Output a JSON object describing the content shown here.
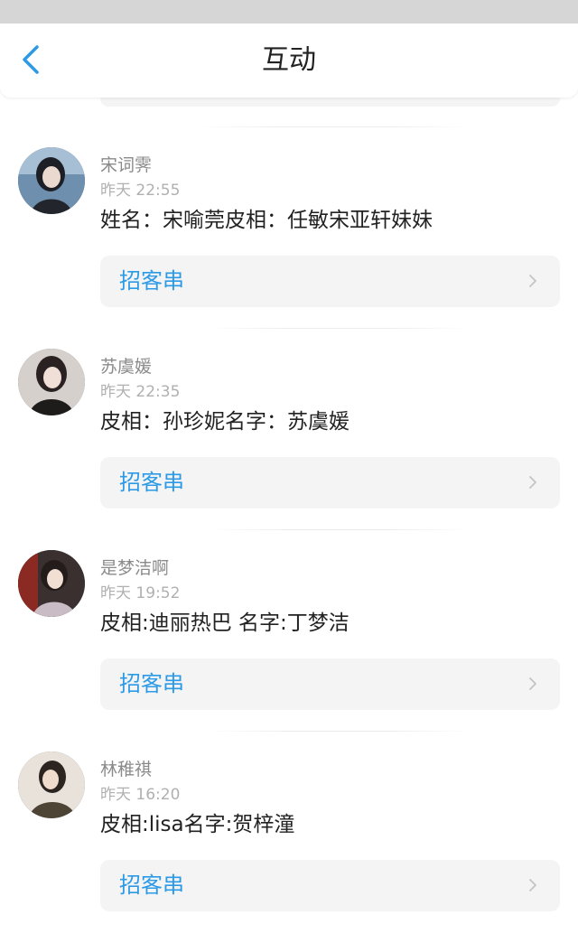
{
  "nav": {
    "title": "互动",
    "back_icon": "chevron-left-icon"
  },
  "colors": {
    "accent": "#2d9ae6",
    "card_bg": "#f4f4f4",
    "name_gray": "#8a8a8a",
    "time_gray": "#b0b0b0",
    "text": "#222222"
  },
  "items": [
    {
      "name": "宋词霁",
      "time": "昨天 22:55",
      "comment": "姓名：宋喻莞皮相：任敏宋亚轩妹妹",
      "link_label": "招客串"
    },
    {
      "name": "苏虞媛",
      "time": "昨天 22:35",
      "comment": "皮相：孙珍妮名字：苏虞媛",
      "link_label": "招客串"
    },
    {
      "name": "是梦洁啊",
      "time": "昨天 19:52",
      "comment": "皮相:迪丽热巴 名字:丁梦洁",
      "link_label": "招客串"
    },
    {
      "name": "林稚祺",
      "time": "昨天 16:20",
      "comment": "皮相:lisa名字:贺梓潼",
      "link_label": "招客串"
    }
  ]
}
